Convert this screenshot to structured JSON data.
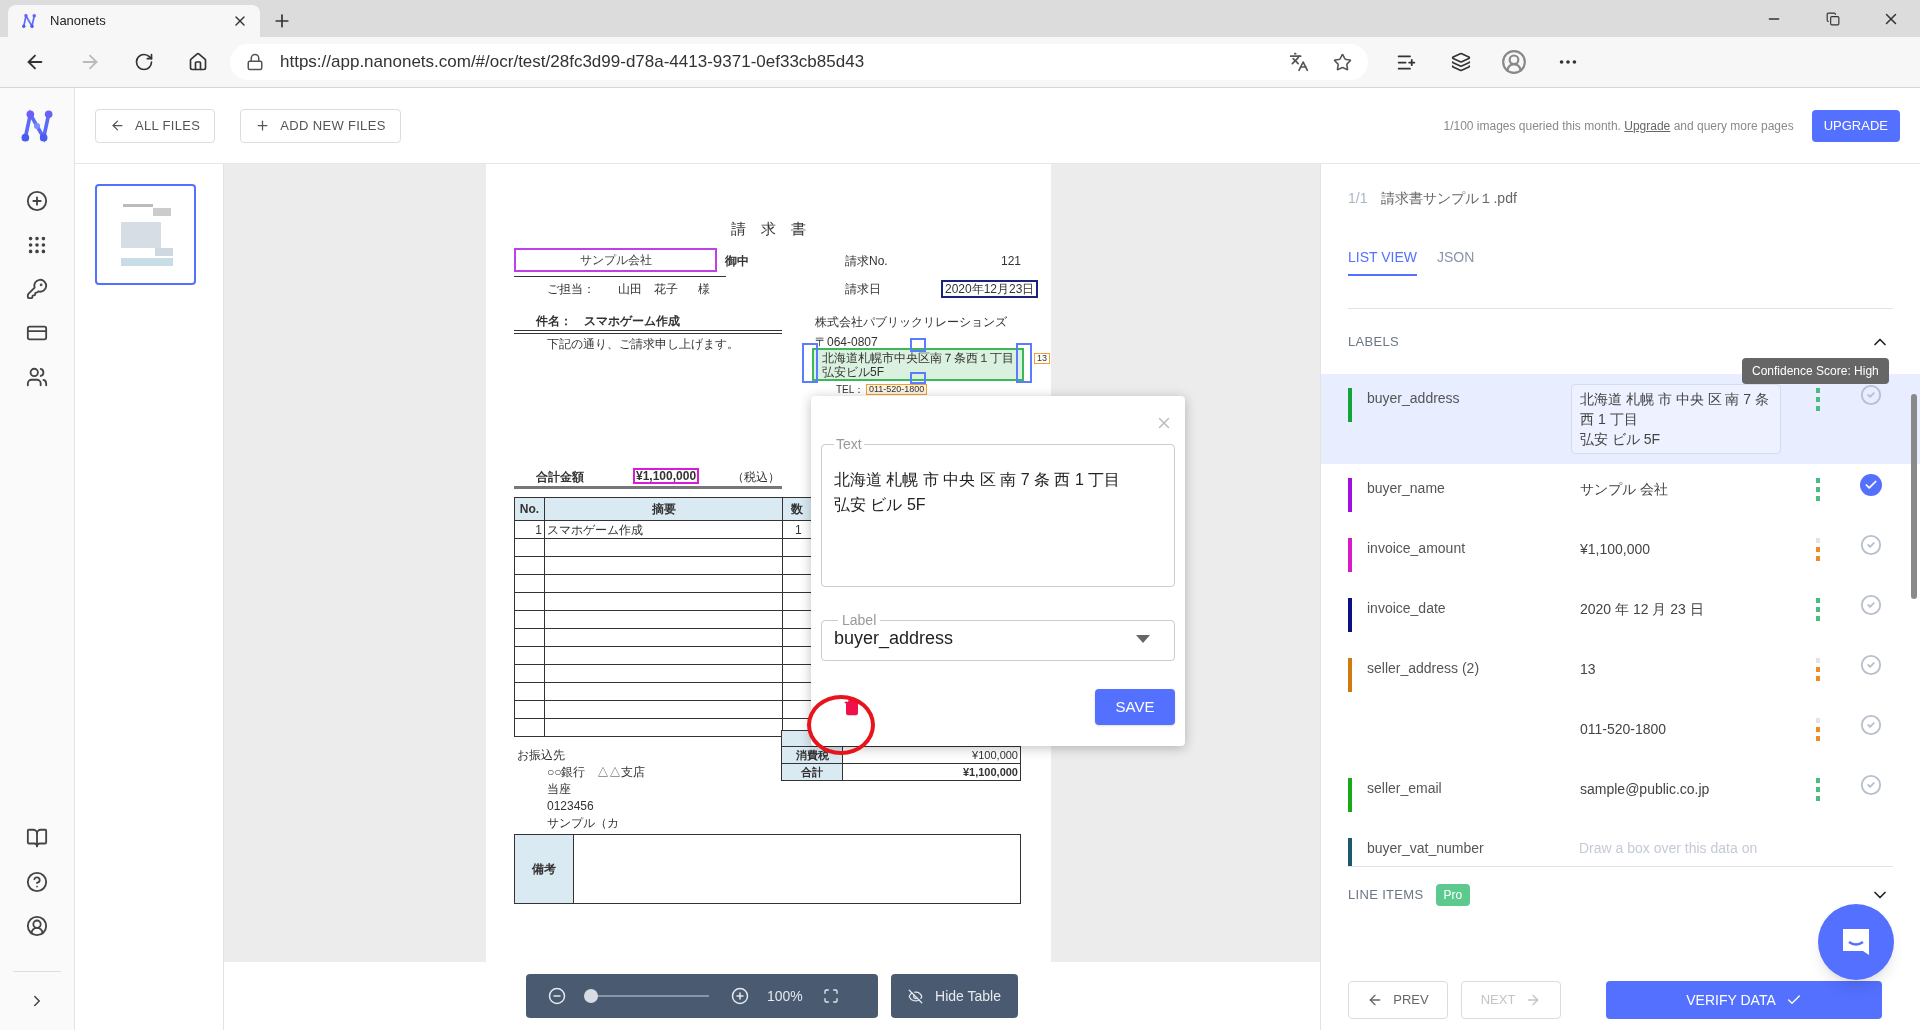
{
  "browser": {
    "tab_title": "Nanonets",
    "url": "https://app.nanonets.com/#/ocr/test/28fc3d99-d78a-4413-9371-0ef33cb85d43"
  },
  "header": {
    "all_files": "ALL FILES",
    "add_files": "ADD NEW FILES",
    "usage_text": "1/100 images queried this month.",
    "upgrade_link": "Upgrade",
    "usage_suffix": "and query more pages",
    "upgrade_button": "UPGRADE"
  },
  "thumbnails": [
    {
      "selected": true
    }
  ],
  "invoice": {
    "title": "請　求　書",
    "client": "サンプル会社",
    "honorific": "御中",
    "contact_label": "ご担当：",
    "contact_name": "山田　花子",
    "contact_suffix": "様",
    "invoice_no_label": "請求No.",
    "invoice_no": "121",
    "date_label": "請求日",
    "date": "2020年12月23日",
    "subject": "件名：　スマホゲーム作成",
    "greeting": "下記の通り、ご請求申し上げます。",
    "company": "株式会社パブリックリレーションズ",
    "postal": "〒064-0807",
    "address_1": "北海道札幌市中央区南７条西１丁目",
    "address_2": "弘安ビル5F",
    "address_number": "13",
    "tel_label": "TEL：",
    "tel": "011-520-1800",
    "total_label": "合計金額",
    "total": "¥1,100,000",
    "tax_note": "（税込）",
    "table": {
      "columns": [
        "No.",
        "摘要",
        "数"
      ],
      "rows": [
        [
          "1",
          "スマホゲーム作成",
          "1"
        ]
      ]
    },
    "summary": [
      {
        "label": "消費税",
        "value": "¥100,000"
      },
      {
        "label": "合計",
        "value": "¥1,100,000"
      }
    ],
    "bank": [
      "お振込先",
      "○○銀行　△△支店",
      "当座",
      "0123456",
      "サンプル（カ"
    ],
    "remarks_label": "備考"
  },
  "viewer_toolbar": {
    "level": 0,
    "zoom": "100%",
    "hide_table": "Hide Table"
  },
  "edit_popup": {
    "text_legend": "Text",
    "text_lines": [
      "北海道 札幌 市 中央 区 南 7 条 西 1 丁目",
      "弘安 ビル 5F"
    ],
    "label_legend": "Label",
    "label_value": "buyer_address",
    "save": "SAVE"
  },
  "panel": {
    "page": "1/1",
    "file_name": "請求書サンプル１.pdf",
    "tabs": [
      {
        "label": "LIST VIEW",
        "selected": true
      },
      {
        "label": "JSON",
        "selected": false
      }
    ],
    "labels_heading": "LABELS",
    "tooltip": "Confidence Score: High",
    "labels": [
      {
        "name": "buyer_address",
        "color": "#13a538",
        "selected": true,
        "values": [
          {
            "lines": [
              "北海道 札幌 市 中央 区 南 7 条",
              "西 1 丁目",
              "弘安 ビル 5F"
            ],
            "high_confidence": true,
            "verified": false
          }
        ]
      },
      {
        "name": "buyer_name",
        "color": "#a10fe0",
        "selected": false,
        "values": [
          {
            "lines": [
              "サンプル 会社"
            ],
            "high_confidence": true,
            "verified": true
          }
        ]
      },
      {
        "name": "invoice_amount",
        "color": "#d81bc8",
        "selected": false,
        "values": [
          {
            "lines": [
              "¥1,100,000"
            ],
            "high_confidence": false,
            "verified": false
          }
        ]
      },
      {
        "name": "invoice_date",
        "color": "#0d1080",
        "selected": false,
        "values": [
          {
            "lines": [
              "2020 年 12 月 23 日"
            ],
            "high_confidence": true,
            "verified": false
          }
        ]
      },
      {
        "name": "seller_address (2)",
        "color": "#d07a10",
        "selected": false,
        "values": [
          {
            "lines": [
              "13"
            ],
            "high_confidence": false,
            "verified": false
          },
          {
            "lines": [
              "011-520-1800"
            ],
            "high_confidence": false,
            "verified": false
          }
        ]
      },
      {
        "name": "seller_email",
        "color": "#18a818",
        "selected": false,
        "values": [
          {
            "lines": [
              "sample@public.co.jp"
            ],
            "high_confidence": true,
            "verified": false
          }
        ]
      },
      {
        "name": "buyer_vat_number",
        "color": "#1a5a6a",
        "selected": false,
        "values": [
          {
            "placeholder": "Draw a box over this data on"
          }
        ]
      }
    ],
    "line_items": "LINE ITEMS",
    "pro_badge": "Pro",
    "prev": "PREV",
    "next": {
      "label": "NEXT",
      "disabled": true
    },
    "verify": "VERIFY DATA"
  }
}
